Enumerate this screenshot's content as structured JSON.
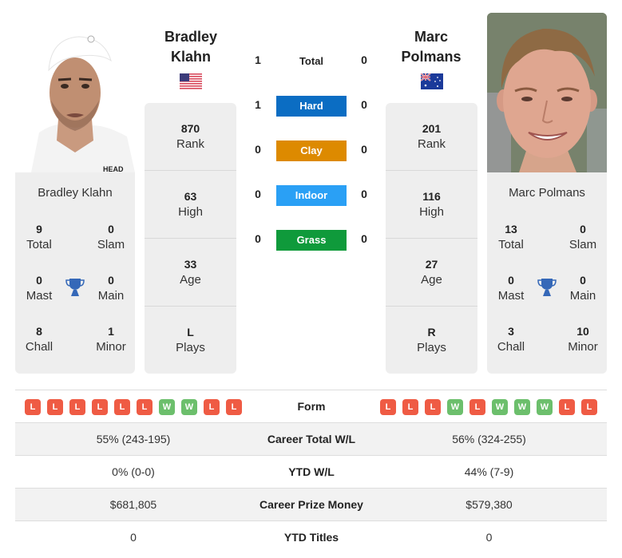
{
  "colors": {
    "hard": "#0b6dc3",
    "clay": "#dd8a00",
    "indoor": "#2aa0f5",
    "grass": "#0f9a3b",
    "win": "#6cbf6c",
    "loss": "#ef5b44",
    "trophy": "#3568b8",
    "card_bg": "#eeeeee"
  },
  "player1": {
    "name_line1": "Bradley",
    "name_line2": "Klahn",
    "full_name": "Bradley Klahn",
    "flag": "usa-flag",
    "rank": "870",
    "rank_label": "Rank",
    "high": "63",
    "high_label": "High",
    "age": "33",
    "age_label": "Age",
    "plays": "L",
    "plays_label": "Plays",
    "titles": {
      "total": "9",
      "total_label": "Total",
      "slam": "0",
      "slam_label": "Slam",
      "mast": "0",
      "mast_label": "Mast",
      "main": "0",
      "main_label": "Main",
      "chall": "8",
      "chall_label": "Chall",
      "minor": "1",
      "minor_label": "Minor"
    },
    "form": [
      "L",
      "L",
      "L",
      "L",
      "L",
      "L",
      "W",
      "W",
      "L",
      "L"
    ],
    "career_wl": "55% (243-195)",
    "ytd_wl": "0% (0-0)",
    "prize_money": "$681,805",
    "ytd_titles": "0"
  },
  "player2": {
    "name_line1": "Marc",
    "name_line2": "Polmans",
    "full_name": "Marc Polmans",
    "flag": "australia-flag",
    "rank": "201",
    "rank_label": "Rank",
    "high": "116",
    "high_label": "High",
    "age": "27",
    "age_label": "Age",
    "plays": "R",
    "plays_label": "Plays",
    "titles": {
      "total": "13",
      "total_label": "Total",
      "slam": "0",
      "slam_label": "Slam",
      "mast": "0",
      "mast_label": "Mast",
      "main": "0",
      "main_label": "Main",
      "chall": "3",
      "chall_label": "Chall",
      "minor": "10",
      "minor_label": "Minor"
    },
    "form": [
      "L",
      "L",
      "L",
      "W",
      "L",
      "W",
      "W",
      "W",
      "L",
      "L"
    ],
    "career_wl": "56% (324-255)",
    "ytd_wl": "44% (7-9)",
    "prize_money": "$579,380",
    "ytd_titles": "0"
  },
  "h2h": [
    {
      "label": "Total",
      "p1": "1",
      "p2": "0"
    },
    {
      "label": "Hard",
      "p1": "1",
      "p2": "0"
    },
    {
      "label": "Clay",
      "p1": "0",
      "p2": "0"
    },
    {
      "label": "Indoor",
      "p1": "0",
      "p2": "0"
    },
    {
      "label": "Grass",
      "p1": "0",
      "p2": "0"
    }
  ],
  "table": {
    "form_label": "Form",
    "career_wl_label": "Career Total W/L",
    "ytd_wl_label": "YTD W/L",
    "prize_label": "Career Prize Money",
    "ytd_titles_label": "YTD Titles"
  }
}
